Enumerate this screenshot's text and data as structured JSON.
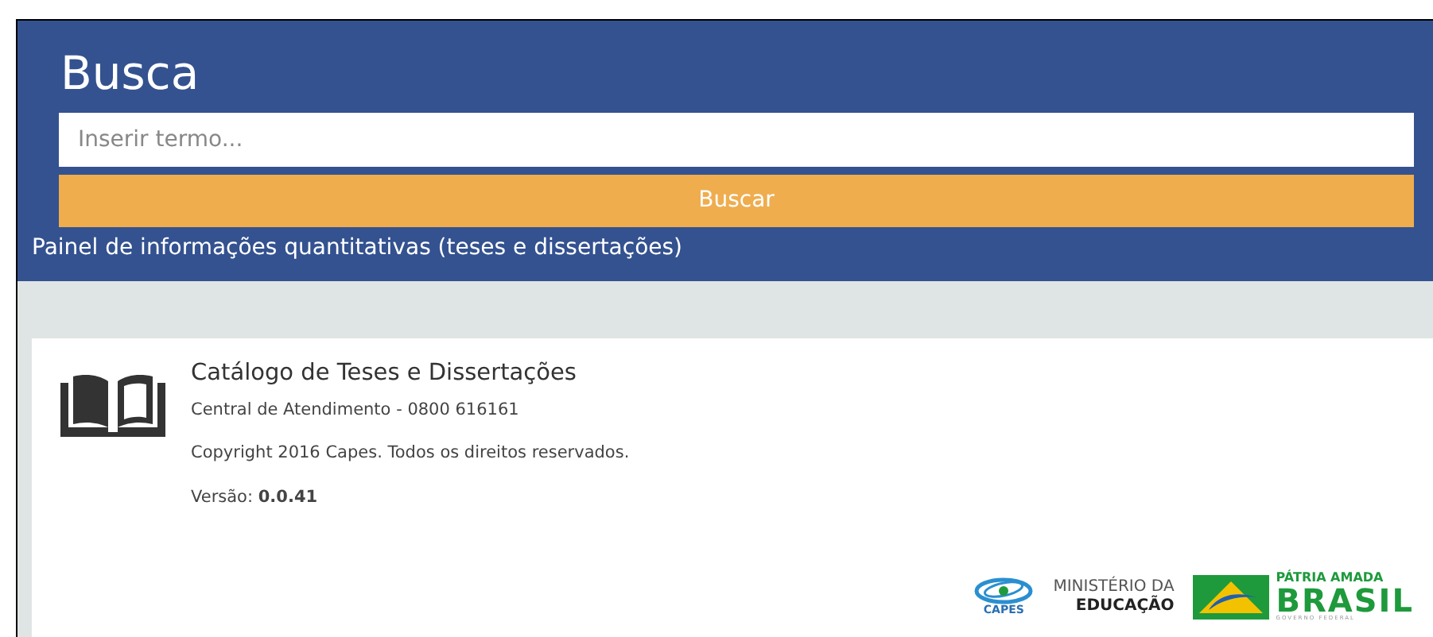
{
  "header": {
    "title": "Busca",
    "search": {
      "placeholder": "Inserir termo..."
    },
    "button": "Buscar",
    "link": "Painel de informações quantitativas (teses e dissertações)"
  },
  "footer": {
    "title": "Catálogo de Teses e Dissertações",
    "lines": [
      "Central de Atendimento - 0800 616161",
      "Copyright 2016 Capes. Todos os direitos reservados.",
      "Versão: **0.0.41**"
    ],
    "logos": [
      {
        "kind": "capes",
        "texts": [
          "CAPES"
        ]
      },
      {
        "kind": "ministry",
        "texts": [
          "MINISTÉRIO DA",
          "EDUCAÇÃO"
        ]
      },
      {
        "kind": "government",
        "texts": [
          "PÁTRIA AMADA",
          "BRASIL",
          "GOVERNO FEDERAL"
        ]
      }
    ]
  }
}
